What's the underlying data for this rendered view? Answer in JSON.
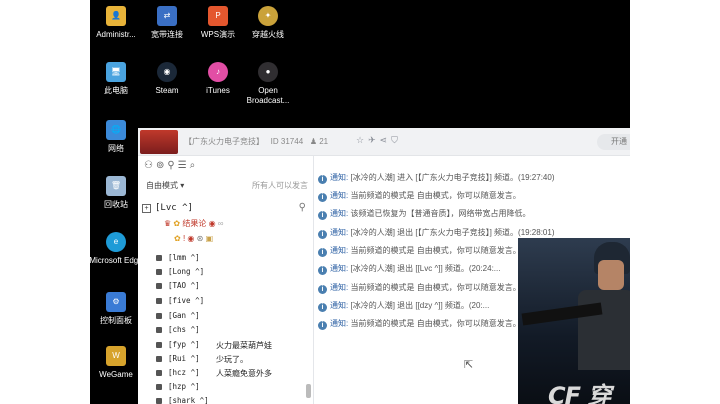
{
  "desktop": {
    "icons": [
      {
        "label": "Administr...",
        "icon": "folder-user-icon",
        "color": "#e8b339"
      },
      {
        "label": "宽带连接",
        "icon": "network-icon",
        "color": "#3a6fc4"
      },
      {
        "label": "WPS演示",
        "icon": "wps-presentation-icon",
        "color": "#e4572e"
      },
      {
        "label": "穿越火线",
        "icon": "crossfire-icon",
        "color": "#caa23a"
      },
      {
        "label": "此电脑",
        "icon": "computer-icon",
        "color": "#4aa3df"
      },
      {
        "label": "Steam",
        "icon": "steam-icon",
        "color": "#1b2838"
      },
      {
        "label": "iTunes",
        "icon": "itunes-icon",
        "color": "#e24ea5"
      },
      {
        "label": "Open Broadcast...",
        "icon": "obs-icon",
        "color": "#302e31"
      },
      {
        "label": "网络",
        "icon": "globe-icon",
        "color": "#3b8ad9"
      },
      {
        "label": "回收站",
        "icon": "recycle-bin-icon",
        "color": "#9bb7d4"
      },
      {
        "label": "Microsoft Edge",
        "icon": "edge-icon",
        "color": "#1e9bd7"
      },
      {
        "label": "控制面板",
        "icon": "control-panel-icon",
        "color": "#3a7bd5"
      },
      {
        "label": "WeGame",
        "icon": "wegame-icon",
        "color": "#d7a32c"
      }
    ]
  },
  "window": {
    "channel_title": "【广东火力电子竞技】",
    "room_id": "ID 31744",
    "online_count": "♟ 21",
    "open_button": "开通"
  },
  "sidebar": {
    "mode": "自由模式 ▾",
    "mode_right": "所有人可以发言",
    "room_name": "[Lvc   ^]",
    "expand_symbol": "+",
    "vip1": "结果论",
    "vip2": "!",
    "members": [
      {
        "name": "[lmm     ^]",
        "chat": ""
      },
      {
        "name": "[Long    ^]",
        "chat": ""
      },
      {
        "name": "[TAO     ^]",
        "chat": ""
      },
      {
        "name": "[five    ^]",
        "chat": ""
      },
      {
        "name": "[Gan     ^]",
        "chat": ""
      },
      {
        "name": "[chs     ^]",
        "chat": ""
      },
      {
        "name": "[fyp     ^]",
        "chat": "火力最菜葫芦娃"
      },
      {
        "name": "[Rui     ^]",
        "chat": "少玩了。"
      },
      {
        "name": "[hcz     ^]",
        "chat": "人菜瘾免意外多"
      },
      {
        "name": "[hzp     ^]",
        "chat": ""
      },
      {
        "name": "[shark   ^]",
        "chat": ""
      }
    ]
  },
  "messages": [
    {
      "prefix": "通知:",
      "text": "[冰冷的人潮] 进入 [【广东火力电子竞技】] 频道。(19:27:40)"
    },
    {
      "prefix": "通知:",
      "text": "当前频道的模式是 自由模式，你可以随意发言。"
    },
    {
      "prefix": "通知:",
      "text": "该频道已恢复为【普通音质】，网络带宽占用降低。"
    },
    {
      "prefix": "通知:",
      "text": "[冰冷的人潮] 退出 [【广东火力电子竞技】] 频道。(19:28:01)"
    },
    {
      "prefix": "通知:",
      "text": "当前频道的模式是 自由模式，你可以随意发言。"
    },
    {
      "prefix": "通知:",
      "text": "[冰冷的人潮] 退出 [[Lvc    ^]] 频道。(20:24:..."
    },
    {
      "prefix": "通知:",
      "text": "当前频道的模式是 自由模式，你可以随意发言。"
    },
    {
      "prefix": "通知:",
      "text": "[冰冷的人潮] 退出 [[dzy    ^]] 频道。(20:..."
    },
    {
      "prefix": "通知:",
      "text": "当前频道的模式是 自由模式，你可以随意发言。"
    }
  ],
  "overlay": {
    "brand_text": "CF 穿"
  }
}
